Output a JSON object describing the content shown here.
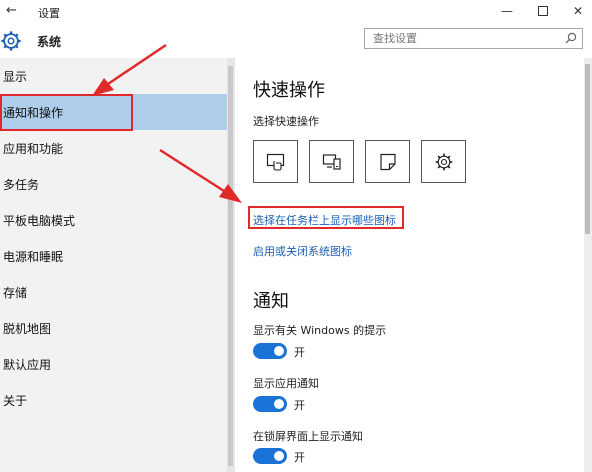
{
  "window": {
    "title": "设置",
    "back_glyph": "←",
    "min_glyph": "—",
    "close_glyph": "✕"
  },
  "header": {
    "title": "系统",
    "icon": "gear-icon"
  },
  "search": {
    "placeholder": "查找设置",
    "value": ""
  },
  "sidebar": {
    "items": [
      {
        "label": "显示",
        "selected": false
      },
      {
        "label": "通知和操作",
        "selected": true
      },
      {
        "label": "应用和功能",
        "selected": false
      },
      {
        "label": "多任务",
        "selected": false
      },
      {
        "label": "平板电脑模式",
        "selected": false
      },
      {
        "label": "电源和睡眠",
        "selected": false
      },
      {
        "label": "存储",
        "selected": false
      },
      {
        "label": "脱机地图",
        "selected": false
      },
      {
        "label": "默认应用",
        "selected": false
      },
      {
        "label": "关于",
        "selected": false
      }
    ]
  },
  "quick_actions": {
    "title": "快速操作",
    "subtitle": "选择快速操作",
    "tiles": [
      {
        "icon": "tablet-mode-icon"
      },
      {
        "icon": "connect-icon"
      },
      {
        "icon": "note-icon"
      },
      {
        "icon": "settings-gear-icon"
      }
    ],
    "link_taskbar": "选择在任务栏上显示哪些图标",
    "link_system_icons": "启用或关闭系统图标"
  },
  "notifications": {
    "title": "通知",
    "settings": [
      {
        "label": "显示有关 Windows 的提示",
        "state": "开",
        "on": true
      },
      {
        "label": "显示应用通知",
        "state": "开",
        "on": true
      },
      {
        "label": "在锁屏界面上显示通知",
        "state": "开",
        "on": true
      }
    ]
  },
  "colors": {
    "accent": "#1a73d6",
    "selected_nav": "#aecdea",
    "link": "#1a5fb4",
    "annotation": "#e02a2a"
  }
}
